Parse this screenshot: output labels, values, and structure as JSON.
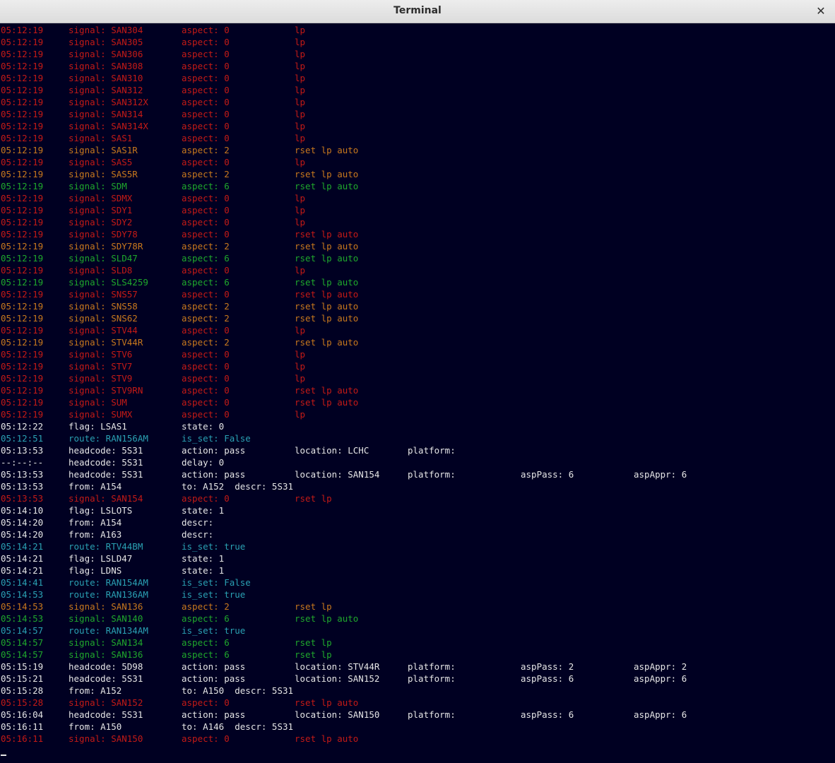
{
  "window": {
    "title": "Terminal",
    "close_glyph": "✕"
  },
  "colors": {
    "red": "#c41a16",
    "orange": "#c8781d",
    "green": "#1fa82c",
    "cyan": "#2aa1b3",
    "white": "#e6e6e6",
    "background": "#000022"
  },
  "terminal": {
    "lines": [
      {
        "color": "red",
        "cols": [
          "05:12:19",
          "signal: SAN304",
          "aspect: 0",
          "lp"
        ]
      },
      {
        "color": "red",
        "cols": [
          "05:12:19",
          "signal: SAN305",
          "aspect: 0",
          "lp"
        ]
      },
      {
        "color": "red",
        "cols": [
          "05:12:19",
          "signal: SAN306",
          "aspect: 0",
          "lp"
        ]
      },
      {
        "color": "red",
        "cols": [
          "05:12:19",
          "signal: SAN308",
          "aspect: 0",
          "lp"
        ]
      },
      {
        "color": "red",
        "cols": [
          "05:12:19",
          "signal: SAN310",
          "aspect: 0",
          "lp"
        ]
      },
      {
        "color": "red",
        "cols": [
          "05:12:19",
          "signal: SAN312",
          "aspect: 0",
          "lp"
        ]
      },
      {
        "color": "red",
        "cols": [
          "05:12:19",
          "signal: SAN312X",
          "aspect: 0",
          "lp"
        ]
      },
      {
        "color": "red",
        "cols": [
          "05:12:19",
          "signal: SAN314",
          "aspect: 0",
          "lp"
        ]
      },
      {
        "color": "red",
        "cols": [
          "05:12:19",
          "signal: SAN314X",
          "aspect: 0",
          "lp"
        ]
      },
      {
        "color": "red",
        "cols": [
          "05:12:19",
          "signal: SAS1",
          "aspect: 0",
          "lp"
        ]
      },
      {
        "color": "orange",
        "cols": [
          "05:12:19",
          "signal: SAS1R",
          "aspect: 2",
          "rset lp auto"
        ]
      },
      {
        "color": "red",
        "cols": [
          "05:12:19",
          "signal: SAS5",
          "aspect: 0",
          "lp"
        ]
      },
      {
        "color": "orange",
        "cols": [
          "05:12:19",
          "signal: SAS5R",
          "aspect: 2",
          "rset lp auto"
        ]
      },
      {
        "color": "green",
        "cols": [
          "05:12:19",
          "signal: SDM",
          "aspect: 6",
          "rset lp auto"
        ]
      },
      {
        "color": "red",
        "cols": [
          "05:12:19",
          "signal: SDMX",
          "aspect: 0",
          "lp"
        ]
      },
      {
        "color": "red",
        "cols": [
          "05:12:19",
          "signal: SDY1",
          "aspect: 0",
          "lp"
        ]
      },
      {
        "color": "red",
        "cols": [
          "05:12:19",
          "signal: SDY2",
          "aspect: 0",
          "lp"
        ]
      },
      {
        "color": "red",
        "cols": [
          "05:12:19",
          "signal: SDY78",
          "aspect: 0",
          "rset lp auto"
        ]
      },
      {
        "color": "orange",
        "cols": [
          "05:12:19",
          "signal: SDY78R",
          "aspect: 2",
          "rset lp auto"
        ]
      },
      {
        "color": "green",
        "cols": [
          "05:12:19",
          "signal: SLD47",
          "aspect: 6",
          "rset lp auto"
        ]
      },
      {
        "color": "red",
        "cols": [
          "05:12:19",
          "signal: SLD8",
          "aspect: 0",
          "lp"
        ]
      },
      {
        "color": "green",
        "cols": [
          "05:12:19",
          "signal: SLS4259",
          "aspect: 6",
          "rset lp auto"
        ]
      },
      {
        "color": "red",
        "cols": [
          "05:12:19",
          "signal: SNS57",
          "aspect: 0",
          "rset lp auto"
        ]
      },
      {
        "color": "orange",
        "cols": [
          "05:12:19",
          "signal: SNS58",
          "aspect: 2",
          "rset lp auto"
        ]
      },
      {
        "color": "orange",
        "cols": [
          "05:12:19",
          "signal: SNS62",
          "aspect: 2",
          "rset lp auto"
        ]
      },
      {
        "color": "red",
        "cols": [
          "05:12:19",
          "signal: STV44",
          "aspect: 0",
          "lp"
        ]
      },
      {
        "color": "orange",
        "cols": [
          "05:12:19",
          "signal: STV44R",
          "aspect: 2",
          "rset lp auto"
        ]
      },
      {
        "color": "red",
        "cols": [
          "05:12:19",
          "signal: STV6",
          "aspect: 0",
          "lp"
        ]
      },
      {
        "color": "red",
        "cols": [
          "05:12:19",
          "signal: STV7",
          "aspect: 0",
          "lp"
        ]
      },
      {
        "color": "red",
        "cols": [
          "05:12:19",
          "signal: STV9",
          "aspect: 0",
          "lp"
        ]
      },
      {
        "color": "red",
        "cols": [
          "05:12:19",
          "signal: STV9RN",
          "aspect: 0",
          "rset lp auto"
        ]
      },
      {
        "color": "red",
        "cols": [
          "05:12:19",
          "signal: SUM",
          "aspect: 0",
          "rset lp auto"
        ]
      },
      {
        "color": "red",
        "cols": [
          "05:12:19",
          "signal: SUMX",
          "aspect: 0",
          "lp"
        ]
      },
      {
        "color": "white",
        "cols": [
          "05:12:22",
          "flag: LSAS1",
          "state: 0"
        ]
      },
      {
        "color": "cyan",
        "cols": [
          "05:12:51",
          "route: RAN156AM",
          "is_set: False"
        ]
      },
      {
        "color": "white",
        "cols": [
          "05:13:53",
          "headcode: 5S31",
          "action: pass",
          "location: LCHC",
          "platform:"
        ]
      },
      {
        "color": "white",
        "cols": [
          "--:--:--",
          "headcode: 5S31",
          "delay: 0"
        ]
      },
      {
        "color": "white",
        "cols": [
          "05:13:53",
          "headcode: 5S31",
          "action: pass",
          "location: SAN154",
          "platform:",
          "aspPass: 6",
          "aspAppr: 6"
        ]
      },
      {
        "color": "white",
        "cols": [
          "05:13:53",
          "from: A154",
          "to: A152  descr: 5S31"
        ]
      },
      {
        "color": "red",
        "cols": [
          "05:13:53",
          "signal: SAN154",
          "aspect: 0",
          "rset lp"
        ]
      },
      {
        "color": "white",
        "cols": [
          "05:14:10",
          "flag: LSLOTS",
          "state: 1"
        ]
      },
      {
        "color": "white",
        "cols": [
          "05:14:20",
          "from: A154",
          "descr:"
        ]
      },
      {
        "color": "white",
        "cols": [
          "05:14:20",
          "from: A163",
          "descr:"
        ]
      },
      {
        "color": "cyan",
        "cols": [
          "05:14:21",
          "route: RTV44BM",
          "is_set: true"
        ]
      },
      {
        "color": "white",
        "cols": [
          "05:14:21",
          "flag: LSLD47",
          "state: 1"
        ]
      },
      {
        "color": "white",
        "cols": [
          "05:14:21",
          "flag: LDNS",
          "state: 1"
        ]
      },
      {
        "color": "cyan",
        "cols": [
          "05:14:41",
          "route: RAN154AM",
          "is_set: False"
        ]
      },
      {
        "color": "cyan",
        "cols": [
          "05:14:53",
          "route: RAN136AM",
          "is_set: true"
        ]
      },
      {
        "color": "orange",
        "cols": [
          "05:14:53",
          "signal: SAN136",
          "aspect: 2",
          "rset lp"
        ]
      },
      {
        "color": "green",
        "cols": [
          "05:14:53",
          "signal: SAN140",
          "aspect: 6",
          "rset lp auto"
        ]
      },
      {
        "color": "cyan",
        "cols": [
          "05:14:57",
          "route: RAN134AM",
          "is_set: true"
        ]
      },
      {
        "color": "green",
        "cols": [
          "05:14:57",
          "signal: SAN134",
          "aspect: 6",
          "rset lp"
        ]
      },
      {
        "color": "green",
        "cols": [
          "05:14:57",
          "signal: SAN136",
          "aspect: 6",
          "rset lp"
        ]
      },
      {
        "color": "white",
        "cols": [
          "05:15:19",
          "headcode: 5D98",
          "action: pass",
          "location: STV44R",
          "platform:",
          "aspPass: 2",
          "aspAppr: 2"
        ]
      },
      {
        "color": "white",
        "cols": [
          "05:15:21",
          "headcode: 5S31",
          "action: pass",
          "location: SAN152",
          "platform:",
          "aspPass: 6",
          "aspAppr: 6"
        ]
      },
      {
        "color": "white",
        "cols": [
          "05:15:28",
          "from: A152",
          "to: A150  descr: 5S31"
        ]
      },
      {
        "color": "red",
        "cols": [
          "05:15:28",
          "signal: SAN152",
          "aspect: 0",
          "rset lp auto"
        ]
      },
      {
        "color": "white",
        "cols": [
          "05:16:04",
          "headcode: 5S31",
          "action: pass",
          "location: SAN150",
          "platform:",
          "aspPass: 6",
          "aspAppr: 6"
        ]
      },
      {
        "color": "white",
        "cols": [
          "05:16:11",
          "from: A150",
          "to: A146  descr: 5S31"
        ]
      },
      {
        "color": "red",
        "cols": [
          "05:16:11",
          "signal: SAN150",
          "aspect: 0",
          "rset lp auto"
        ]
      }
    ]
  }
}
